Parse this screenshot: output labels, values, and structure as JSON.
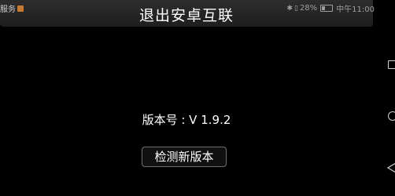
{
  "status_bar": {
    "left_text": "服务",
    "battery": "28%",
    "time_label": "中午11:00"
  },
  "header": {
    "title": "退出安卓互联"
  },
  "main": {
    "version_label": "版本号 : V 1.9.2",
    "check_button_label": "检测新版本"
  },
  "icons": {
    "notification": "notification-icon",
    "bluetooth": "bluetooth-icon",
    "sim": "sim-icon",
    "battery": "battery-icon",
    "recent_apps": "recent-apps-icon",
    "home": "home-icon",
    "back": "back-icon"
  }
}
